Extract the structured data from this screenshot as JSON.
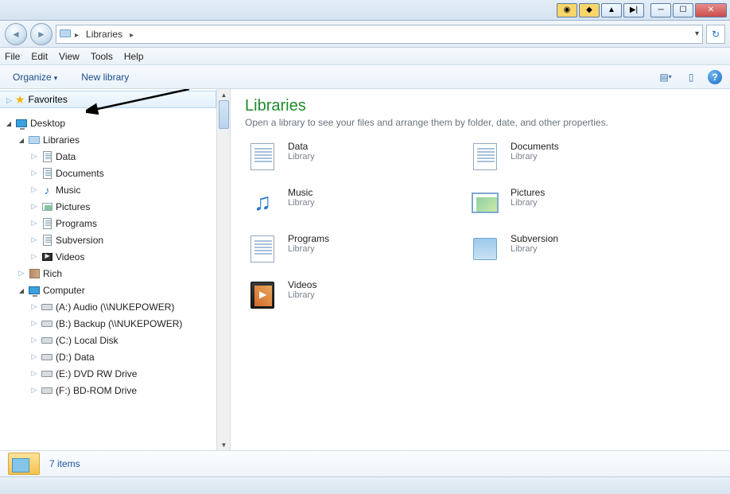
{
  "breadcrumb": {
    "root_icon": "libraries-icon",
    "items": [
      "Libraries"
    ]
  },
  "menu": {
    "file": "File",
    "edit": "Edit",
    "view": "View",
    "tools": "Tools",
    "help": "Help"
  },
  "toolbar": {
    "organize": "Organize",
    "new_library": "New library"
  },
  "tree": {
    "favorites": "Favorites",
    "desktop": "Desktop",
    "libraries": "Libraries",
    "lib_items": [
      {
        "label": "Data",
        "icon": "page-icon"
      },
      {
        "label": "Documents",
        "icon": "page-icon"
      },
      {
        "label": "Music",
        "icon": "music-icon"
      },
      {
        "label": "Pictures",
        "icon": "picture-icon"
      },
      {
        "label": "Programs",
        "icon": "page-icon"
      },
      {
        "label": "Subversion",
        "icon": "page-icon"
      },
      {
        "label": "Videos",
        "icon": "video-icon"
      }
    ],
    "rich": "Rich",
    "computer": "Computer",
    "drives": [
      "(A:) Audio (\\\\NUKEPOWER)",
      "(B:) Backup (\\\\NUKEPOWER)",
      "(C:) Local Disk",
      "(D:) Data",
      "(E:) DVD RW Drive",
      "(F:) BD-ROM Drive"
    ]
  },
  "content": {
    "title": "Libraries",
    "subtitle": "Open a library to see your files and arrange them by folder, date, and other properties.",
    "type_label": "Library",
    "items": [
      {
        "name": "Data",
        "icon": "data"
      },
      {
        "name": "Documents",
        "icon": "documents"
      },
      {
        "name": "Music",
        "icon": "music"
      },
      {
        "name": "Pictures",
        "icon": "pictures"
      },
      {
        "name": "Programs",
        "icon": "programs"
      },
      {
        "name": "Subversion",
        "icon": "subversion"
      },
      {
        "name": "Videos",
        "icon": "videos"
      }
    ]
  },
  "status": {
    "text": "7 items"
  }
}
